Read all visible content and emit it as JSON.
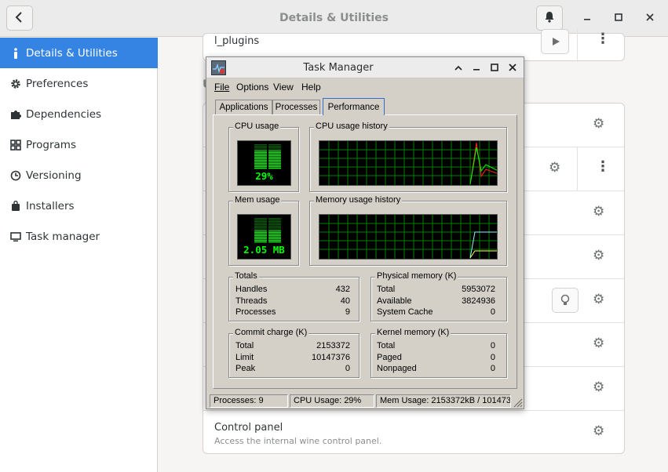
{
  "window": {
    "title": "Details & Utilities",
    "back_icon": "chevron-left-icon",
    "notification_icon": "bell-icon"
  },
  "sidebar": {
    "items": [
      {
        "label": "Details & Utilities",
        "icon": "info-icon",
        "active": true
      },
      {
        "label": "Preferences",
        "icon": "gear-icon"
      },
      {
        "label": "Dependencies",
        "icon": "puzzle-icon"
      },
      {
        "label": "Programs",
        "icon": "grid-icon"
      },
      {
        "label": "Versioning",
        "icon": "history-icon"
      },
      {
        "label": "Installers",
        "icon": "bag-icon"
      },
      {
        "label": "Task manager",
        "icon": "monitor-icon"
      }
    ]
  },
  "main": {
    "top_row_title": "l_plugins",
    "section_letter": "U",
    "control_panel": {
      "title": "Control panel",
      "subtitle": "Access the internal wine control panel."
    }
  },
  "task_manager": {
    "title": "Task Manager",
    "menus": [
      "File",
      "Options",
      "View",
      "Help"
    ],
    "tabs": [
      "Applications",
      "Processes",
      "Performance"
    ],
    "active_tab": "Performance",
    "cpu_usage": {
      "label": "CPU usage",
      "value": "29%",
      "level": 0.29
    },
    "cpu_history": {
      "label": "CPU usage history"
    },
    "mem_usage": {
      "label": "Mem usage",
      "value": "2.05 MB",
      "level": 0.21
    },
    "mem_history": {
      "label": "Memory usage history"
    },
    "totals": {
      "label": "Totals",
      "rows": [
        {
          "k": "Handles",
          "v": "432"
        },
        {
          "k": "Threads",
          "v": "40"
        },
        {
          "k": "Processes",
          "v": "9"
        }
      ]
    },
    "physical": {
      "label": "Physical memory (K)",
      "rows": [
        {
          "k": "Total",
          "v": "5953072"
        },
        {
          "k": "Available",
          "v": "3824936"
        },
        {
          "k": "System Cache",
          "v": "0"
        }
      ]
    },
    "commit": {
      "label": "Commit charge (K)",
      "rows": [
        {
          "k": "Total",
          "v": "2153372"
        },
        {
          "k": "Limit",
          "v": "10147376"
        },
        {
          "k": "Peak",
          "v": "0"
        }
      ]
    },
    "kernel": {
      "label": "Kernel memory (K)",
      "rows": [
        {
          "k": "Total",
          "v": "0"
        },
        {
          "k": "Paged",
          "v": "0"
        },
        {
          "k": "Nonpaged",
          "v": "0"
        }
      ]
    },
    "status": {
      "processes": "Processes: 9",
      "cpu": "CPU Usage:  29%",
      "mem": "Mem Usage: 2153372kB / 101473"
    }
  }
}
